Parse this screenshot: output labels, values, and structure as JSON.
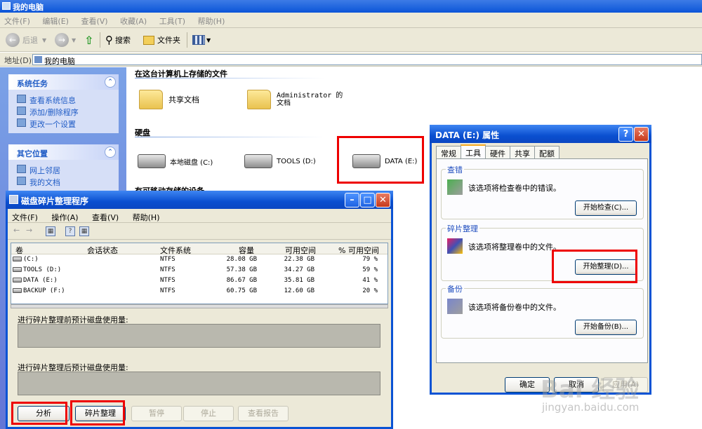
{
  "explorer": {
    "title": "我的电脑",
    "menu": [
      "文件(F)",
      "编辑(E)",
      "查看(V)",
      "收藏(A)",
      "工具(T)",
      "帮助(H)"
    ],
    "toolbar": {
      "back": "后退",
      "search": "搜索",
      "folders": "文件夹"
    },
    "address_label": "地址(D)",
    "address_value": "我的电脑",
    "system_tasks": {
      "title": "系统任务",
      "items": [
        "查看系统信息",
        "添加/删除程序",
        "更改一个设置"
      ]
    },
    "other_places": {
      "title": "其它位置",
      "items": [
        "网上邻居",
        "我的文档"
      ]
    },
    "files_group": "在这台计算机上存储的文件",
    "shared_docs": "共享文档",
    "admin_docs": "Administrator 的文档",
    "hdd_group": "硬盘",
    "drives": [
      "本地磁盘 (C:)",
      "TOOLS (D:)",
      "DATA (E:)"
    ],
    "removable_group": "有可移动存储的设备"
  },
  "defrag": {
    "title": "磁盘碎片整理程序",
    "menu": [
      "文件(F)",
      "操作(A)",
      "查看(V)",
      "帮助(H)"
    ],
    "columns": [
      "卷",
      "会话状态",
      "文件系统",
      "容量",
      "可用空间",
      "% 可用空间"
    ],
    "volumes": [
      {
        "name": "(C:)",
        "fs": "NTFS",
        "capacity": "28.08 GB",
        "free": "22.38 GB",
        "pct": "79 %"
      },
      {
        "name": "TOOLS (D:)",
        "fs": "NTFS",
        "capacity": "57.38 GB",
        "free": "34.27 GB",
        "pct": "59 %"
      },
      {
        "name": "DATA (E:)",
        "fs": "NTFS",
        "capacity": "86.67 GB",
        "free": "35.81 GB",
        "pct": "41 %"
      },
      {
        "name": "BACKUP (F:)",
        "fs": "NTFS",
        "capacity": "60.75 GB",
        "free": "12.60 GB",
        "pct": "20 %"
      }
    ],
    "before_label": "进行碎片整理前预计磁盘使用量:",
    "after_label": "进行碎片整理后预计磁盘使用量:",
    "buttons": {
      "analyze": "分析",
      "defrag": "碎片整理",
      "pause": "暂停",
      "stop": "停止",
      "report": "查看报告"
    }
  },
  "props": {
    "title": "DATA (E:) 属性",
    "tabs": [
      "常规",
      "工具",
      "硬件",
      "共享",
      "配额"
    ],
    "check": {
      "legend": "查错",
      "text": "该选项将检查卷中的错误。",
      "button": "开始检查(C)..."
    },
    "defrag": {
      "legend": "碎片整理",
      "text": "该选项将整理卷中的文件。",
      "button": "开始整理(D)..."
    },
    "backup": {
      "legend": "备份",
      "text": "该选项将备份卷中的文件。",
      "button": "开始备份(B)..."
    },
    "ok": "确定",
    "cancel": "取消",
    "apply": "应用(A)"
  },
  "watermark": {
    "brand": "Bai 经验",
    "url": "jingyan.baidu.com"
  }
}
